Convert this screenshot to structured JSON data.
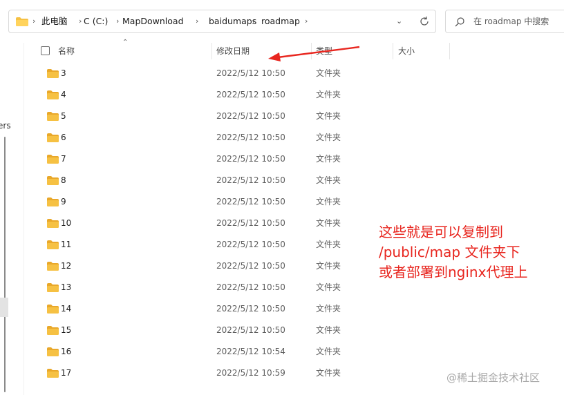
{
  "breadcrumb": {
    "items": [
      "此电脑",
      "C (C:)",
      "MapDownload",
      "baidumaps",
      "roadmap"
    ]
  },
  "search": {
    "placeholder": "在 roadmap 中搜索"
  },
  "left_pane": {
    "clipped_text": "ers"
  },
  "columns": {
    "name": "名称",
    "date": "修改日期",
    "type": "类型",
    "size": "大小"
  },
  "files": [
    {
      "name": "3",
      "date": "2022/5/12 10:50",
      "type": "文件夹"
    },
    {
      "name": "4",
      "date": "2022/5/12 10:50",
      "type": "文件夹"
    },
    {
      "name": "5",
      "date": "2022/5/12 10:50",
      "type": "文件夹"
    },
    {
      "name": "6",
      "date": "2022/5/12 10:50",
      "type": "文件夹"
    },
    {
      "name": "7",
      "date": "2022/5/12 10:50",
      "type": "文件夹"
    },
    {
      "name": "8",
      "date": "2022/5/12 10:50",
      "type": "文件夹"
    },
    {
      "name": "9",
      "date": "2022/5/12 10:50",
      "type": "文件夹"
    },
    {
      "name": "10",
      "date": "2022/5/12 10:50",
      "type": "文件夹"
    },
    {
      "name": "11",
      "date": "2022/5/12 10:50",
      "type": "文件夹"
    },
    {
      "name": "12",
      "date": "2022/5/12 10:50",
      "type": "文件夹"
    },
    {
      "name": "13",
      "date": "2022/5/12 10:50",
      "type": "文件夹"
    },
    {
      "name": "14",
      "date": "2022/5/12 10:50",
      "type": "文件夹"
    },
    {
      "name": "15",
      "date": "2022/5/12 10:50",
      "type": "文件夹"
    },
    {
      "name": "16",
      "date": "2022/5/12 10:54",
      "type": "文件夹"
    },
    {
      "name": "17",
      "date": "2022/5/12 10:59",
      "type": "文件夹"
    }
  ],
  "annotation": {
    "lines": [
      "这些就是可以复制到",
      "/public/map 文件夹下",
      "或者部署到nginx代理上"
    ],
    "color": "#e8261f"
  },
  "watermark": "@稀土掘金技术社区",
  "colors": {
    "folder": "#f6c143",
    "accent": "#e8261f"
  }
}
